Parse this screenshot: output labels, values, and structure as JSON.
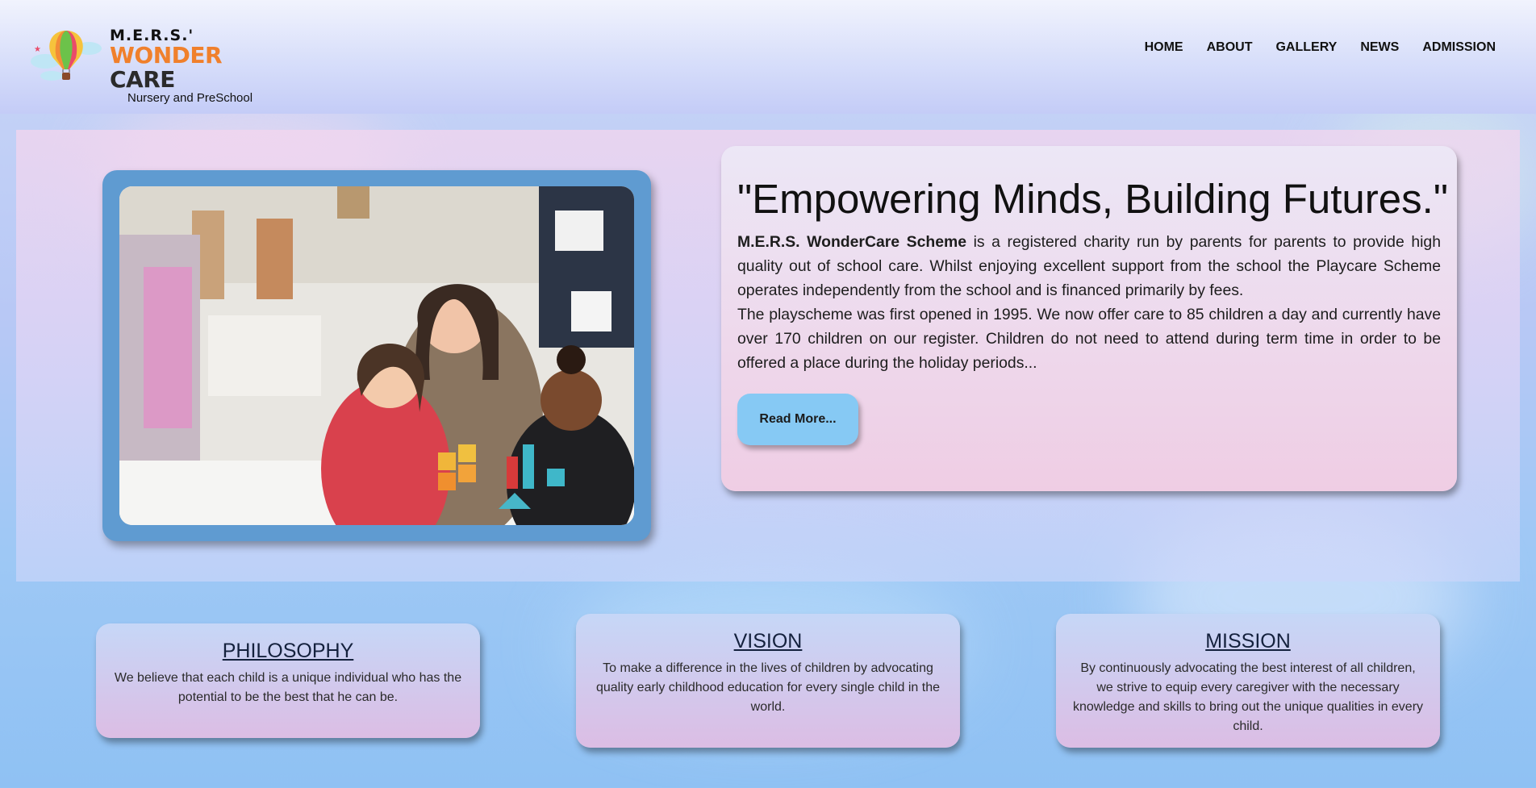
{
  "header": {
    "logo": {
      "line1": "M.E.R.S.'",
      "wonder": "WONDER",
      "care": "CARE",
      "tagline": "Nursery and PreSchool"
    },
    "nav": [
      "HOME",
      "ABOUT",
      "GALLERY",
      "NEWS",
      "ADMISSION"
    ]
  },
  "hero": {
    "image_alt": "Teacher playing with building blocks with two young girls",
    "title": "\"Empowering Minds, Building Futures.\"",
    "paragraph1_bold": "M.E.R.S. WonderCare Scheme",
    "paragraph1_rest": " is a registered charity run by parents for parents to provide high quality out of school care. Whilst enjoying excellent support from the school the Playcare Scheme operates independently from the school and is financed primarily by fees.",
    "paragraph2": "The playscheme was first opened in 1995. We now offer care to 85 children a day and currently have over 170 children on our register. Children do not need to attend during term time in order to be offered a place during the holiday periods...",
    "read_more_label": "Read More..."
  },
  "cards": {
    "philosophy": {
      "title": "PHILOSOPHY",
      "text": "We believe that each child is a unique individual who has the potential to be the best that he can be."
    },
    "vision": {
      "title": "VISION",
      "text": "To make a difference in the lives of children by advocating quality early childhood education for every single child in the world."
    },
    "mission": {
      "title": "MISSION",
      "text": "By continuously advocating the best interest of all children, we strive to equip every caregiver with the necessary knowledge and skills to bring out the unique qualities in every child."
    }
  },
  "colors": {
    "accent_orange": "#f0802c",
    "photo_frame": "#5f9bd1",
    "read_more_button": "#86c9f4"
  }
}
